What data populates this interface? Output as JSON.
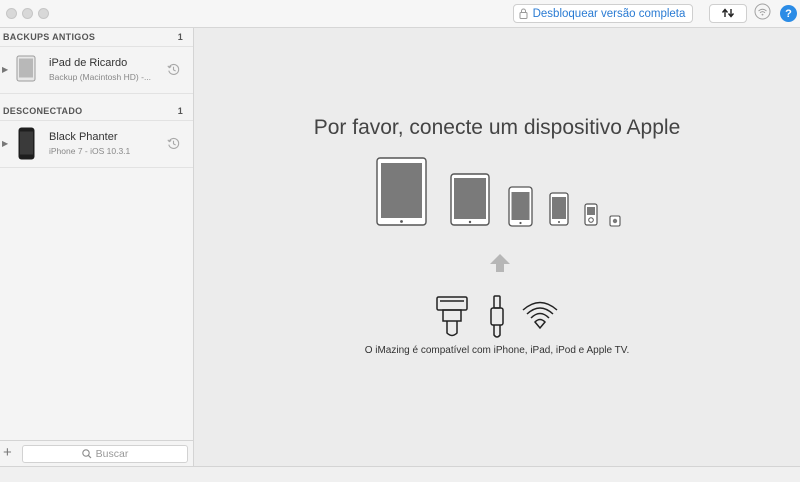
{
  "toolbar": {
    "unlock_label": "Desbloquear versão completa",
    "help_label": "?"
  },
  "sidebar": {
    "sections": [
      {
        "title": "BACKUPS ANTIGOS",
        "count": "1",
        "device": {
          "name": "iPad de Ricardo",
          "sub": "Backup (Macintosh HD) -..."
        }
      },
      {
        "title": "DESCONECTADO",
        "count": "1",
        "device": {
          "name": "Black Phanter",
          "sub": "iPhone 7 - iOS 10.3.1"
        }
      }
    ],
    "add_label": "+",
    "search_placeholder": "Buscar"
  },
  "main": {
    "heading": "Por favor, conecte um dispositivo Apple",
    "compat_text": "O iMazing é compatível com iPhone, iPad, iPod e Apple TV."
  },
  "colors": {
    "accent": "#2a7bd3",
    "help": "#2b8ce6",
    "device_screen": "#7a7a7a"
  }
}
